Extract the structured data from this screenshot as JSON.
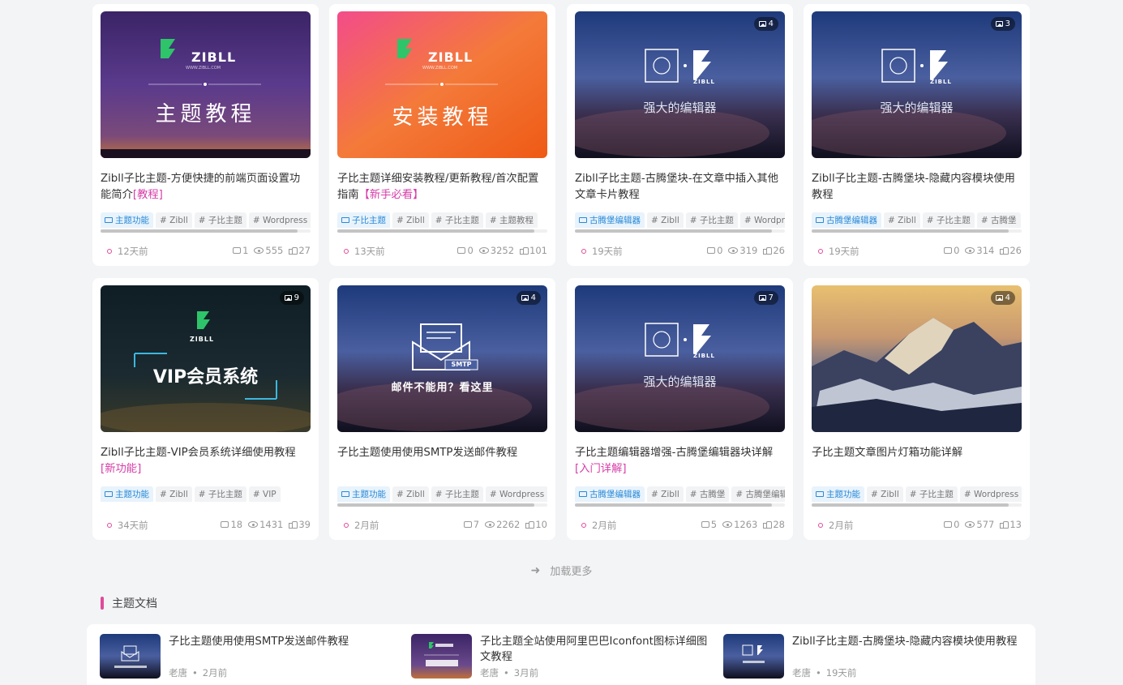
{
  "cards": [
    {
      "title": "Zibll子比主题-方便快捷的前端页面设置功能简介",
      "suffix": "[教程]",
      "thumb_text": "主题教程",
      "thumb_brand": "ZIBLL",
      "thumb_url": "WWW.ZIBLL.COM",
      "category": "主题功能",
      "tags": [
        "# Zibll",
        "# 子比主题",
        "# Wordpress"
      ],
      "time": "12天前",
      "comments": "1",
      "views": "555",
      "likes": "27"
    },
    {
      "title": "子比主题详细安装教程/更新教程/首次配置指南",
      "suffix": "【新手必看】",
      "thumb_text": "安装教程",
      "thumb_brand": "ZIBLL",
      "thumb_url": "WWW.ZIBLL.COM",
      "category": "子比主题",
      "tags": [
        "# Zibll",
        "# 子比主题",
        "# 主题教程"
      ],
      "time": "13天前",
      "comments": "0",
      "views": "3252",
      "likes": "101"
    },
    {
      "title": "Zibll子比主题-古腾堡块-在文章中插入其他文章卡片教程",
      "suffix": "",
      "thumb_text": "强大的编辑器",
      "thumb_brand": "ZIBLL",
      "image_count": "4",
      "category": "古腾堡编辑器",
      "tags": [
        "# Zibll",
        "# 子比主题",
        "# Wordpress"
      ],
      "time": "19天前",
      "comments": "0",
      "views": "319",
      "likes": "26"
    },
    {
      "title": "Zibll子比主题-古腾堡块-隐藏内容模块使用教程",
      "suffix": "",
      "thumb_text": "强大的编辑器",
      "thumb_brand": "ZIBLL",
      "image_count": "3",
      "category": "古腾堡编辑器",
      "tags": [
        "# Zibll",
        "# 子比主题",
        "# 古腾堡"
      ],
      "time": "19天前",
      "comments": "0",
      "views": "314",
      "likes": "26"
    },
    {
      "title": "Zibll子比主题-VIP会员系统详细使用教程",
      "suffix": "[新功能]",
      "thumb_text": "VIP会员系统",
      "thumb_brand": "ZIBLL",
      "image_count": "9",
      "category": "主题功能",
      "tags": [
        "# Zibll",
        "# 子比主题",
        "# VIP"
      ],
      "time": "34天前",
      "comments": "18",
      "views": "1431",
      "likes": "39"
    },
    {
      "title": "子比主题使用使用SMTP发送邮件教程",
      "suffix": "",
      "thumb_text": "邮件不能用？看这里",
      "thumb_badge": "SMTP",
      "image_count": "4",
      "category": "主题功能",
      "tags": [
        "# Zibll",
        "# 子比主题",
        "# Wordpress"
      ],
      "time": "2月前",
      "comments": "7",
      "views": "2262",
      "likes": "10"
    },
    {
      "title": "子比主题编辑器增强-古腾堡编辑器块详解",
      "suffix": "[入门详解]",
      "thumb_text": "强大的编辑器",
      "thumb_brand": "ZIBLL",
      "image_count": "7",
      "category": "古腾堡编辑器",
      "tags": [
        "# Zibll",
        "# 古腾堡",
        "# 古腾堡编辑器"
      ],
      "time": "2月前",
      "comments": "5",
      "views": "1263",
      "likes": "28"
    },
    {
      "title": "子比主题文章图片灯箱功能详解",
      "suffix": "",
      "image_count": "4",
      "category": "主题功能",
      "tags": [
        "# Zibll",
        "# 子比主题",
        "# Wordpress"
      ],
      "time": "2月前",
      "comments": "0",
      "views": "577",
      "likes": "13"
    }
  ],
  "load_more": "加载更多",
  "section_title": "主题文档",
  "docs": [
    {
      "title": "子比主题使用使用SMTP发送邮件教程",
      "author": "老唐",
      "time": "2月前"
    },
    {
      "title": "子比主题全站使用阿里巴巴Iconfont图标详细图文教程",
      "author": "老唐",
      "time": "3月前"
    },
    {
      "title": "Zibll子比主题-古腾堡块-隐藏内容模块使用教程",
      "author": "老唐",
      "time": "19天前"
    }
  ]
}
